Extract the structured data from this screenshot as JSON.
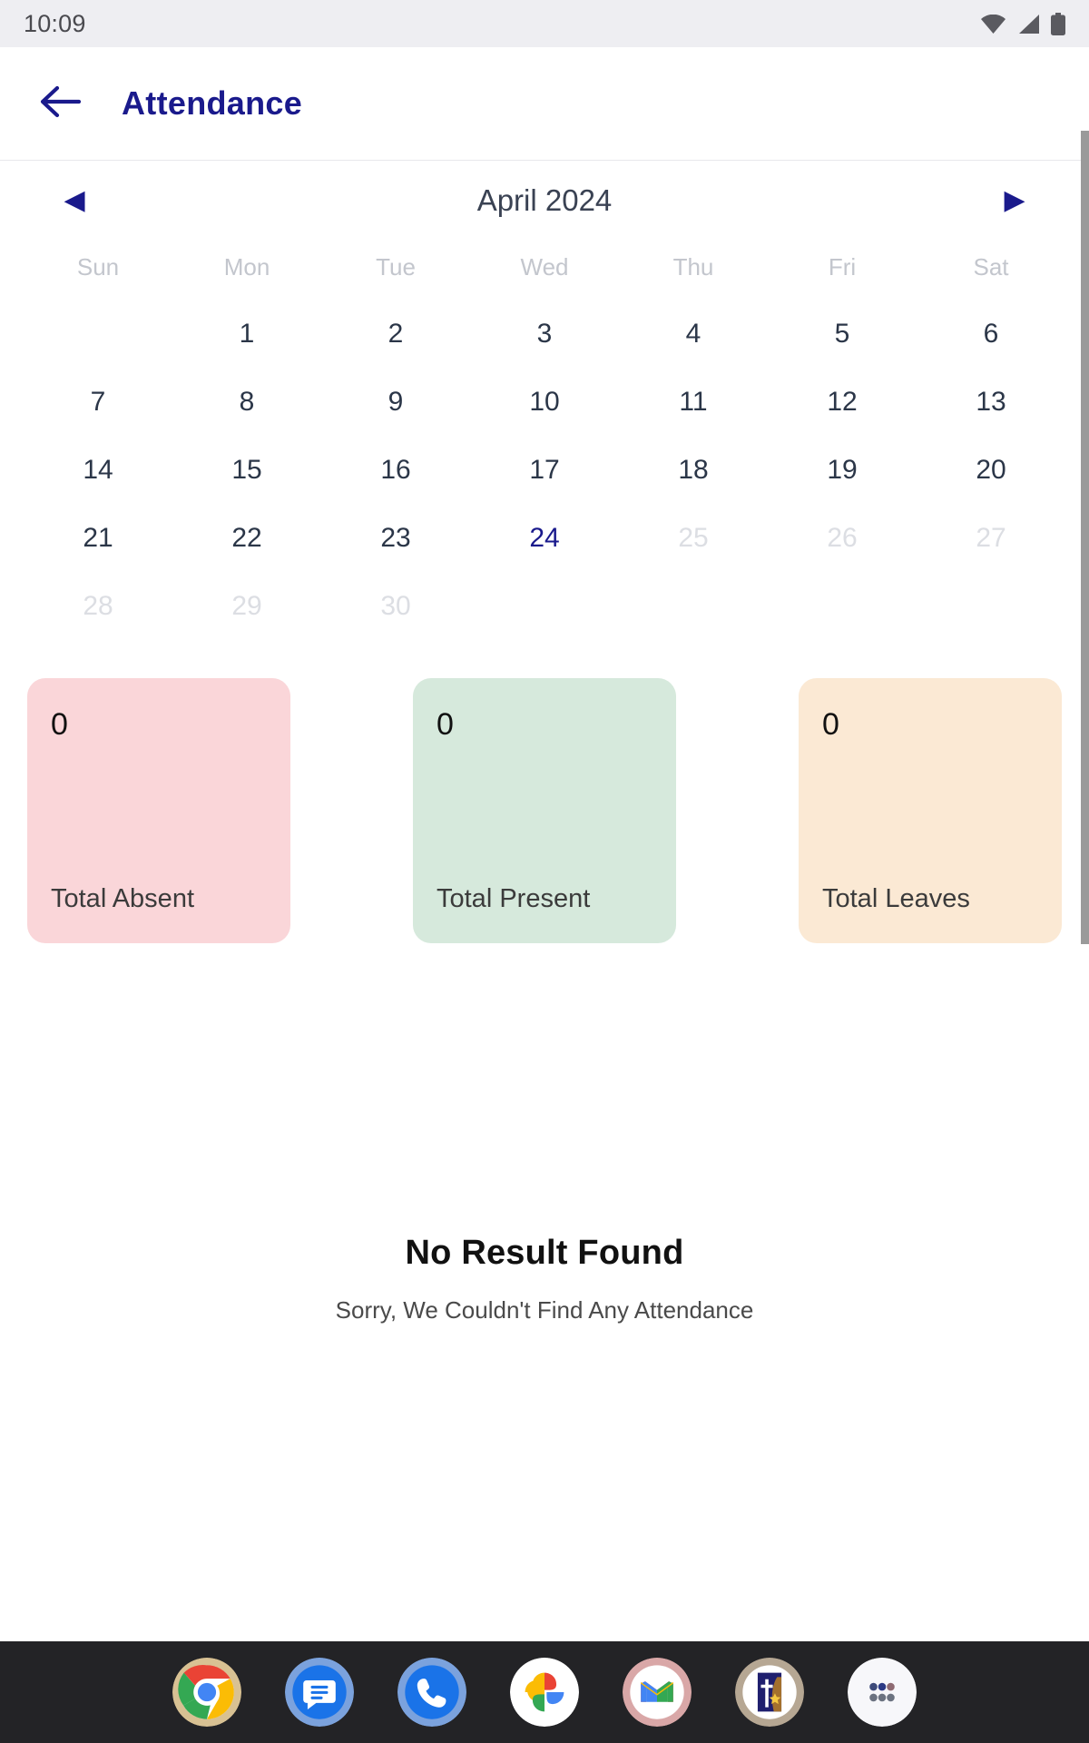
{
  "statusbar": {
    "time": "10:09",
    "icons": [
      "wifi-icon",
      "signal-icon",
      "battery-icon"
    ]
  },
  "appbar": {
    "back_icon": "back-arrow-icon",
    "title": "Attendance",
    "title_color": "#1a1a8c"
  },
  "calendar": {
    "prev_label": "◀",
    "next_label": "▶",
    "month": "April 2024",
    "weekdays": [
      "Sun",
      "Mon",
      "Tue",
      "Wed",
      "Thu",
      "Fri",
      "Sat"
    ],
    "leading_blanks": 1,
    "days": [
      {
        "n": "1",
        "state": "normal"
      },
      {
        "n": "2",
        "state": "normal"
      },
      {
        "n": "3",
        "state": "normal"
      },
      {
        "n": "4",
        "state": "normal"
      },
      {
        "n": "5",
        "state": "normal"
      },
      {
        "n": "6",
        "state": "normal"
      },
      {
        "n": "7",
        "state": "normal"
      },
      {
        "n": "8",
        "state": "normal"
      },
      {
        "n": "9",
        "state": "normal"
      },
      {
        "n": "10",
        "state": "normal"
      },
      {
        "n": "11",
        "state": "normal"
      },
      {
        "n": "12",
        "state": "normal"
      },
      {
        "n": "13",
        "state": "normal"
      },
      {
        "n": "14",
        "state": "normal"
      },
      {
        "n": "15",
        "state": "normal"
      },
      {
        "n": "16",
        "state": "normal"
      },
      {
        "n": "17",
        "state": "normal"
      },
      {
        "n": "18",
        "state": "normal"
      },
      {
        "n": "19",
        "state": "normal"
      },
      {
        "n": "20",
        "state": "normal"
      },
      {
        "n": "21",
        "state": "normal"
      },
      {
        "n": "22",
        "state": "normal"
      },
      {
        "n": "23",
        "state": "normal"
      },
      {
        "n": "24",
        "state": "today"
      },
      {
        "n": "25",
        "state": "muted"
      },
      {
        "n": "26",
        "state": "muted"
      },
      {
        "n": "27",
        "state": "muted"
      },
      {
        "n": "28",
        "state": "muted"
      },
      {
        "n": "29",
        "state": "muted"
      },
      {
        "n": "30",
        "state": "muted"
      }
    ],
    "selected_day": "24",
    "weekday_color": "#c3c6cd",
    "day_color": "#2b3648",
    "muted_color": "#dcdee3"
  },
  "stat_cards": [
    {
      "value": "0",
      "label": "Total Absent",
      "bg": "#fad6d9"
    },
    {
      "value": "0",
      "label": "Total Present",
      "bg": "#d6e9dc"
    },
    {
      "value": "0",
      "label": "Total Leaves",
      "bg": "#fbe9d4"
    }
  ],
  "empty_state": {
    "title": "No Result Found",
    "subtitle": "Sorry, We Couldn't Find Any Attendance"
  },
  "dock": {
    "items": [
      {
        "name": "chrome-icon",
        "label": "Chrome"
      },
      {
        "name": "messages-icon",
        "label": "Messages"
      },
      {
        "name": "phone-icon",
        "label": "Phone"
      },
      {
        "name": "photos-icon",
        "label": "Photos"
      },
      {
        "name": "gmail-icon",
        "label": "Gmail"
      },
      {
        "name": "church-app-icon",
        "label": "Church App"
      },
      {
        "name": "app-drawer-icon",
        "label": "All apps"
      }
    ]
  }
}
